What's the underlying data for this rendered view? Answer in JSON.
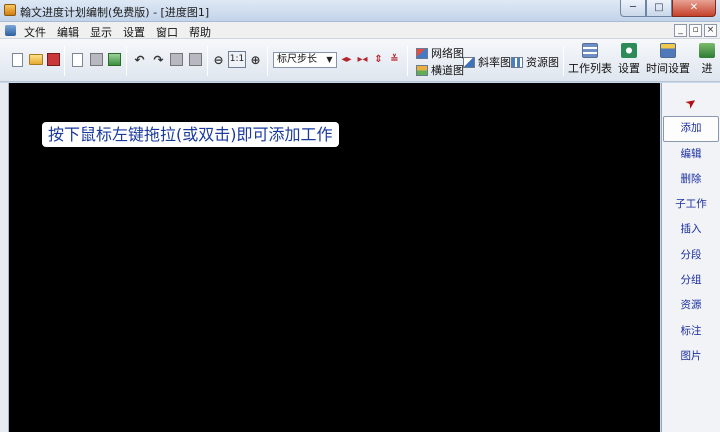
{
  "window": {
    "title": "翰文进度计划编制(免费版) - [进度图1]",
    "controls": [
      "─",
      "□",
      "✕"
    ]
  },
  "menubar": {
    "items": [
      "文件",
      "编辑",
      "显示",
      "设置",
      "窗口",
      "帮助"
    ],
    "mdi_controls": [
      "_",
      "▫",
      "×"
    ]
  },
  "toolbar": {
    "zoom_one_label": "1:1",
    "scale_combo_value": "标尺步长",
    "views": {
      "network": "网络图",
      "gantt": "横道图",
      "slope": "斜率图",
      "resource": "资源图"
    },
    "big_buttons": {
      "task_list": "工作列表",
      "settings": "设置",
      "time_settings": "时间设置",
      "more": "进"
    }
  },
  "canvas": {
    "hint": "按下鼠标左键拖拉(或双击)即可添加工作"
  },
  "side_panel": {
    "items": [
      "添加",
      "编辑",
      "删除",
      "子工作",
      "插入",
      "分段",
      "分组",
      "资源",
      "标注",
      "图片"
    ],
    "active_index": 0
  }
}
